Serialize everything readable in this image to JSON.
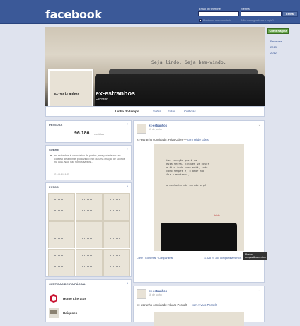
{
  "header": {
    "logo": "facebook",
    "email_label": "Email ou telefone",
    "password_label": "Senha",
    "login_button": "Entrar",
    "keep_connected": "Mantenha-me conectado",
    "forgot": "Não consegue fazer o login?"
  },
  "cover": {
    "text": "Seja lindo. Seja bem-vindo."
  },
  "profile": {
    "pic_text": "ex-estranhos",
    "name": "ex-estranhos",
    "category": "Escritor"
  },
  "tabs": [
    "Linha do tempo",
    "Sobre",
    "Fotos",
    "Curtidas"
  ],
  "right": {
    "like_button": "Curtir Página",
    "years": [
      "Recentes",
      "2013",
      "2012"
    ]
  },
  "people": {
    "heading": "PESSOAS",
    "count": "96.186",
    "count_label": "curtidas"
  },
  "about": {
    "heading": "SOBRE",
    "text": "ex-estranhos é um coletivo de poetas, mas poderia ser um coletivo de abelhas produzindo mel ou uma criação de sonhos na cuia. Não, não somos sábios...",
    "more": "SAIBA MAIS"
  },
  "photos": {
    "heading": "FOTOS"
  },
  "liked": {
    "heading": "CURTIDAS DESTA PÁGINA",
    "items": [
      "Homo Literatus",
      "Haiquoes"
    ]
  },
  "post1": {
    "author": "ex-estranhos",
    "time": "17 de junho",
    "message_prefix": "ex-estranho convidado: Hildo Góes — ",
    "message_with": "com Hildo Góes",
    "poem": "teu coração que é de\nessa serra, ninguém vê mover\ne fica tudo como está, todo\ncomo sempre é, o amor não\nfor a montanha,\n\n\na montanha não arreda o pé.",
    "signature": "hildo",
    "tooltip": "Mostrar compartilhamentos",
    "actions": "Curtir · Comentar · Compartilhar",
    "stats": "1.328  24  385 compartilhamentos"
  },
  "post2": {
    "author": "ex-estranhos",
    "time": "16 de junho",
    "message_prefix": "ex-estranho convidado: Alvaro Posselt — ",
    "message_with": "com Alvaro Posselt"
  }
}
